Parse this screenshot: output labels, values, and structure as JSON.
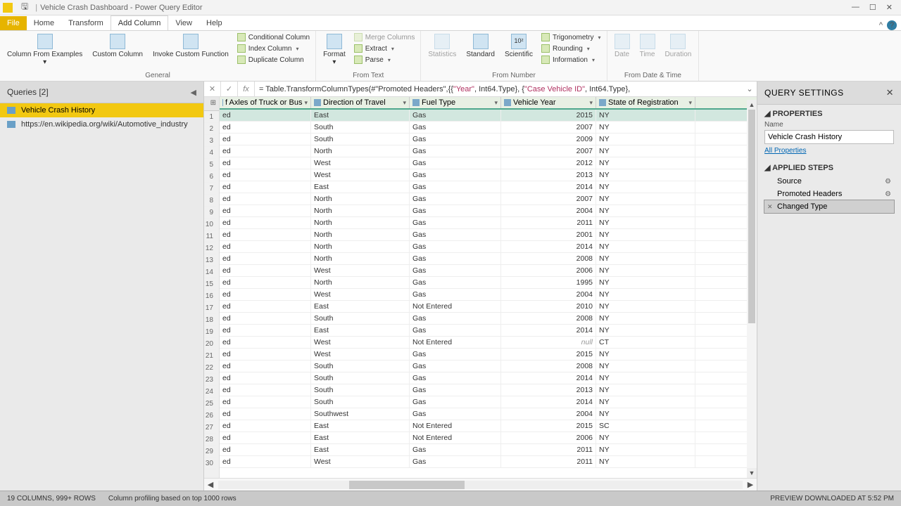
{
  "title": {
    "app": "Vehicle Crash Dashboard - Power Query Editor"
  },
  "tabs": {
    "file": "File",
    "home": "Home",
    "transform": "Transform",
    "addcol": "Add Column",
    "view": "View",
    "help": "Help"
  },
  "ribbon": {
    "general": {
      "col_from_examples": "Column From Examples",
      "custom_column": "Custom Column",
      "invoke_custom": "Invoke Custom Function",
      "conditional": "Conditional Column",
      "index": "Index Column",
      "duplicate": "Duplicate Column",
      "label": "General"
    },
    "fromtext": {
      "format": "Format",
      "merge": "Merge Columns",
      "extract": "Extract",
      "parse": "Parse",
      "label": "From Text"
    },
    "fromnumber": {
      "statistics": "Statistics",
      "standard": "Standard",
      "scientific": "Scientific",
      "trig": "Trigonometry",
      "rounding": "Rounding",
      "information": "Information",
      "label": "From Number"
    },
    "fromdate": {
      "date": "Date",
      "time": "Time",
      "duration": "Duration",
      "label": "From Date & Time"
    }
  },
  "queries": {
    "header": "Queries [2]",
    "items": [
      {
        "label": "Vehicle Crash History"
      },
      {
        "label": "https://en.wikipedia.org/wiki/Automotive_industry"
      }
    ]
  },
  "formula": {
    "prefix": "= Table.TransformColumnTypes(#\"Promoted Headers\",{{",
    "year": "\"Year\"",
    "mid": ", Int64.Type}, {",
    "caseid": "\"Case Vehicle ID\"",
    "suffix": ", Int64.Type},"
  },
  "columns": {
    "c0": "f Axles of Truck or Bus",
    "c1": "Direction of Travel",
    "c2": "Fuel Type",
    "c3": "Vehicle Year",
    "c4": "State of Registration"
  },
  "rows": [
    {
      "a": "ed",
      "d": "East",
      "f": "Gas",
      "y": "2015",
      "s": "NY"
    },
    {
      "a": "ed",
      "d": "South",
      "f": "Gas",
      "y": "2007",
      "s": "NY"
    },
    {
      "a": "ed",
      "d": "South",
      "f": "Gas",
      "y": "2009",
      "s": "NY"
    },
    {
      "a": "ed",
      "d": "North",
      "f": "Gas",
      "y": "2007",
      "s": "NY"
    },
    {
      "a": "ed",
      "d": "West",
      "f": "Gas",
      "y": "2012",
      "s": "NY"
    },
    {
      "a": "ed",
      "d": "West",
      "f": "Gas",
      "y": "2013",
      "s": "NY"
    },
    {
      "a": "ed",
      "d": "East",
      "f": "Gas",
      "y": "2014",
      "s": "NY"
    },
    {
      "a": "ed",
      "d": "North",
      "f": "Gas",
      "y": "2007",
      "s": "NY"
    },
    {
      "a": "ed",
      "d": "North",
      "f": "Gas",
      "y": "2004",
      "s": "NY"
    },
    {
      "a": "ed",
      "d": "North",
      "f": "Gas",
      "y": "2011",
      "s": "NY"
    },
    {
      "a": "ed",
      "d": "North",
      "f": "Gas",
      "y": "2001",
      "s": "NY"
    },
    {
      "a": "ed",
      "d": "North",
      "f": "Gas",
      "y": "2014",
      "s": "NY"
    },
    {
      "a": "ed",
      "d": "North",
      "f": "Gas",
      "y": "2008",
      "s": "NY"
    },
    {
      "a": "ed",
      "d": "West",
      "f": "Gas",
      "y": "2006",
      "s": "NY"
    },
    {
      "a": "ed",
      "d": "North",
      "f": "Gas",
      "y": "1995",
      "s": "NY"
    },
    {
      "a": "ed",
      "d": "West",
      "f": "Gas",
      "y": "2004",
      "s": "NY"
    },
    {
      "a": "ed",
      "d": "East",
      "f": "Not Entered",
      "y": "2010",
      "s": "NY"
    },
    {
      "a": "ed",
      "d": "South",
      "f": "Gas",
      "y": "2008",
      "s": "NY"
    },
    {
      "a": "ed",
      "d": "East",
      "f": "Gas",
      "y": "2014",
      "s": "NY"
    },
    {
      "a": "ed",
      "d": "West",
      "f": "Not Entered",
      "y": "null",
      "s": "CT",
      "ynull": true
    },
    {
      "a": "ed",
      "d": "West",
      "f": "Gas",
      "y": "2015",
      "s": "NY"
    },
    {
      "a": "ed",
      "d": "South",
      "f": "Gas",
      "y": "2008",
      "s": "NY"
    },
    {
      "a": "ed",
      "d": "South",
      "f": "Gas",
      "y": "2014",
      "s": "NY"
    },
    {
      "a": "ed",
      "d": "South",
      "f": "Gas",
      "y": "2013",
      "s": "NY"
    },
    {
      "a": "ed",
      "d": "South",
      "f": "Gas",
      "y": "2014",
      "s": "NY"
    },
    {
      "a": "ed",
      "d": "Southwest",
      "f": "Gas",
      "y": "2004",
      "s": "NY"
    },
    {
      "a": "ed",
      "d": "East",
      "f": "Not Entered",
      "y": "2015",
      "s": "SC"
    },
    {
      "a": "ed",
      "d": "East",
      "f": "Not Entered",
      "y": "2006",
      "s": "NY"
    },
    {
      "a": "ed",
      "d": "East",
      "f": "Gas",
      "y": "2011",
      "s": "NY"
    },
    {
      "a": "ed",
      "d": "West",
      "f": "Gas",
      "y": "2011",
      "s": "NY"
    }
  ],
  "settings": {
    "header": "QUERY SETTINGS",
    "properties": "PROPERTIES",
    "name_label": "Name",
    "name_value": "Vehicle Crash History",
    "all_props": "All Properties",
    "applied_steps": "APPLIED STEPS",
    "steps": [
      {
        "label": "Source",
        "gear": true
      },
      {
        "label": "Promoted Headers",
        "gear": true
      },
      {
        "label": "Changed Type",
        "gear": false,
        "active": true
      }
    ]
  },
  "status": {
    "cols_rows": "19 COLUMNS, 999+ ROWS",
    "profiling": "Column profiling based on top 1000 rows",
    "preview": "PREVIEW DOWNLOADED AT 5:52 PM"
  }
}
